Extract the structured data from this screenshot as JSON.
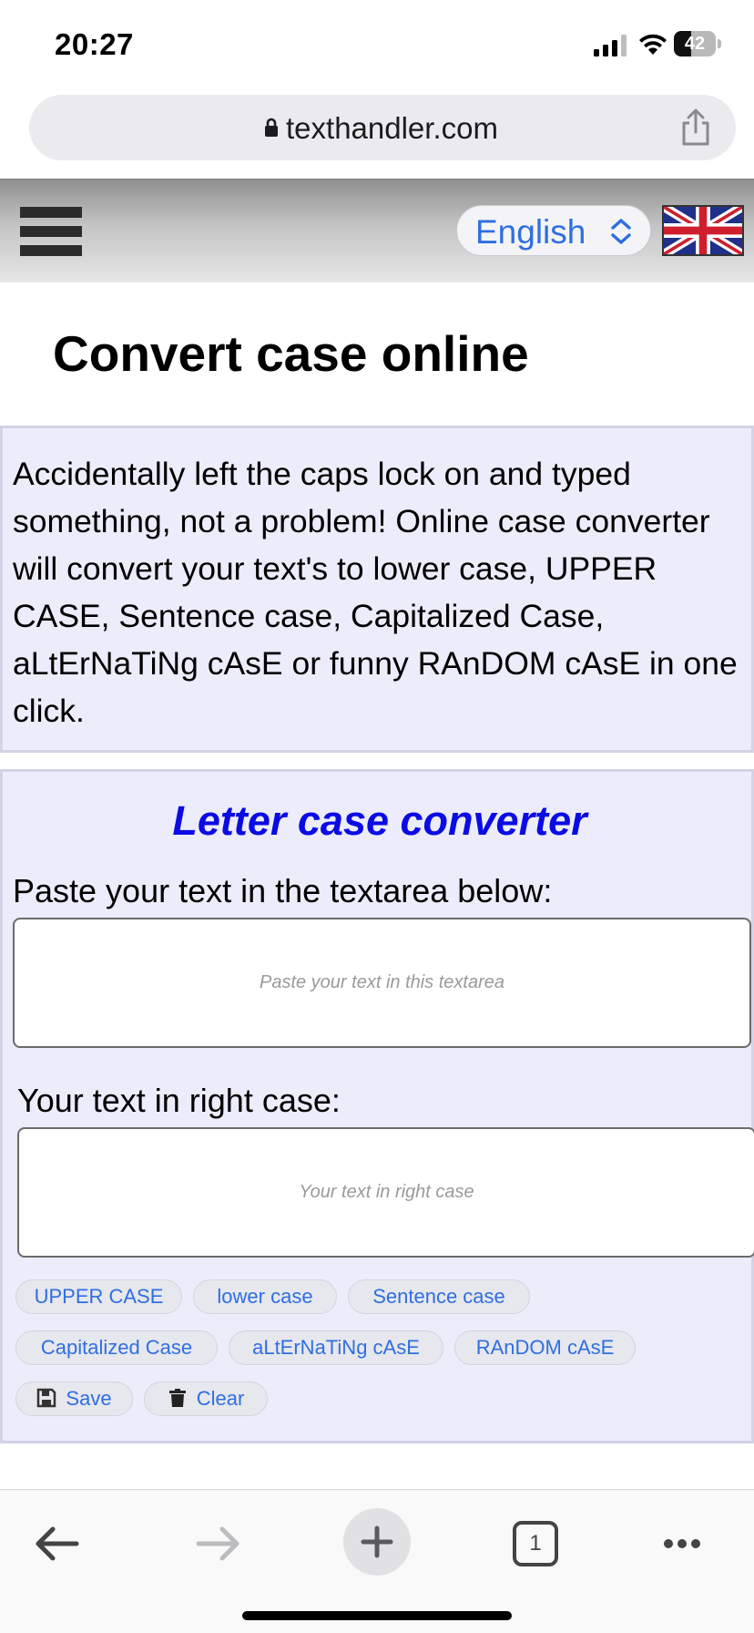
{
  "status_bar": {
    "time": "20:27",
    "battery_level": "42",
    "battery_fraction": 0.42
  },
  "browser": {
    "url": "texthandler.com",
    "tab_count": "1"
  },
  "site_header": {
    "language_select": "English"
  },
  "page": {
    "title": "Convert case online",
    "intro": "Accidentally left the caps lock on and typed something, not a problem! Online case converter will convert your text's to lower case, UPPER CASE, Sentence case, Capitalized Case, aLtErNaTiNg cAsE or funny RAnDOM cAsE in one click."
  },
  "converter": {
    "heading": "Letter case converter",
    "input_label": "Paste your text in the textarea below:",
    "input_placeholder": "Paste your text in this textarea",
    "output_label": "Your text in right case:",
    "output_placeholder": "Your text in right case",
    "buttons": {
      "upper": "UPPER CASE",
      "lower": "lower case",
      "sentence": "Sentence case",
      "capitalized": "Capitalized Case",
      "alternating": "aLtErNaTiNg cAsE",
      "random": "RAnDOM cAsE",
      "save": "Save",
      "clear": "Clear"
    }
  },
  "icons": {
    "lock": "lock-icon",
    "share": "share-icon",
    "menu": "hamburger-menu-icon",
    "chevron": "chevron-up-down-icon",
    "flag": "uk-flag-icon",
    "save": "floppy-disk-icon",
    "clear": "trash-icon",
    "back": "back-arrow-icon",
    "forward": "forward-arrow-icon",
    "new_tab": "plus-icon",
    "tabs": "tabs-icon",
    "more": "more-icon"
  },
  "colors": {
    "accent": "#2f6fe0",
    "heading_blue": "#0b0be3",
    "panel_bg": "#ececfb"
  }
}
